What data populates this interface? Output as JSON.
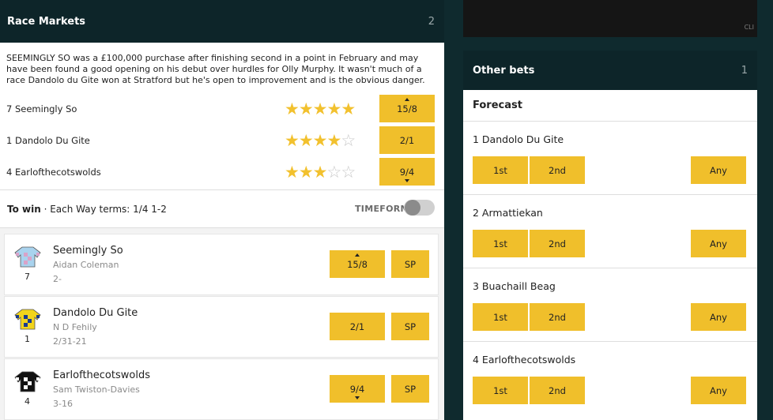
{
  "race_markets": {
    "title": "Race Markets",
    "count": "2",
    "verdict": "SEEMINGLY SO was a £100,000 purchase after finishing second in a point in February and may have been found a good opening on his debut over hurdles for Olly Murphy. It wasn't much of a race Dandolo du Gite won at Stratford but he's open to improvement and is the obvious danger.",
    "tips": [
      {
        "label": "7  Seemingly So",
        "stars": 5,
        "odds": "15/8",
        "arrow": "up"
      },
      {
        "label": "1  Dandolo Du Gite",
        "stars": 4,
        "odds": "2/1",
        "arrow": "none"
      },
      {
        "label": "4  Earlofthecotswolds",
        "stars": 3,
        "odds": "9/4",
        "arrow": "down"
      }
    ],
    "to_win_label": "To win",
    "each_way": " · Each Way terms: 1/4 1-2",
    "timeform": "TIMEFORM",
    "runners": [
      {
        "number": "7",
        "name": "Seemingly So",
        "jockey": "Aidan Coleman",
        "form": "2-",
        "price": "15/8",
        "arrow": "up",
        "sp": "SP",
        "silk_colors": [
          "#a9d3ee",
          "#d9a3c8"
        ]
      },
      {
        "number": "1",
        "name": "Dandolo Du Gite",
        "jockey": "N D Fehily",
        "form": "2/31-21",
        "price": "2/1",
        "arrow": "none",
        "sp": "SP",
        "silk_colors": [
          "#f2d41c",
          "#1a3a8f"
        ]
      },
      {
        "number": "4",
        "name": "Earlofthecotswolds",
        "jockey": "Sam Twiston-Davies",
        "form": "3-16",
        "price": "9/4",
        "arrow": "down",
        "sp": "SP",
        "silk_colors": [
          "#111111",
          "#ffffff"
        ]
      }
    ]
  },
  "video": {
    "badge": "CLI"
  },
  "other_bets": {
    "title": "Other bets",
    "count": "1",
    "forecast_title": "Forecast",
    "buttons": {
      "first": "1st",
      "second": "2nd",
      "any": "Any"
    },
    "entries": [
      {
        "label": "1 Dandolo Du Gite"
      },
      {
        "label": "2 Armattiekan"
      },
      {
        "label": "3 Buachaill Beag"
      },
      {
        "label": "4 Earlofthecotswolds"
      }
    ]
  },
  "colors": {
    "accent": "#f0bf2b",
    "header": "#0d2529",
    "background": "#0f2a2e"
  }
}
